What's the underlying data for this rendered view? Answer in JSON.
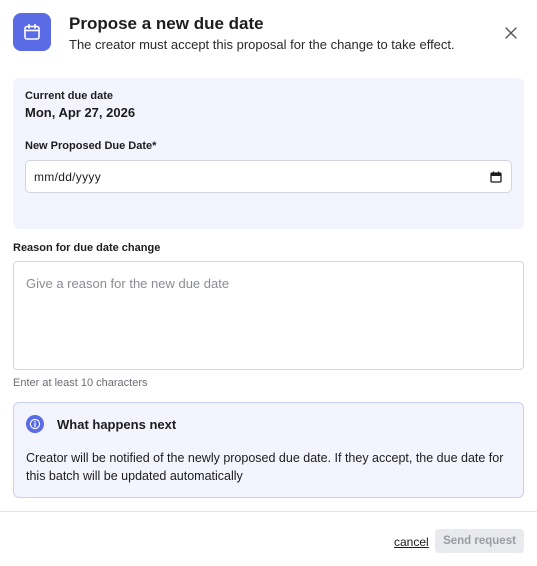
{
  "header": {
    "icon": "calendar-icon",
    "title": "Propose a new due date",
    "subtitle": "The creator must accept this proposal for the change to take effect.",
    "close_icon": "close-icon"
  },
  "current_due": {
    "label": "Current due date",
    "value": "Mon, Apr 27, 2026"
  },
  "new_due": {
    "label": "New Proposed Due Date*",
    "value": "mm/dd/yyyy",
    "picker_icon": "calendar-picker-icon"
  },
  "reason": {
    "label": "Reason for due date change",
    "placeholder": "Give a reason for the new due date",
    "value": "",
    "hint": "Enter at least 10 characters"
  },
  "info": {
    "icon": "info-icon",
    "title": "What happens next",
    "text": "Creator will be notified of the newly proposed due date. If they accept, the due date for this batch will be updated automatically"
  },
  "footer": {
    "cancel_label": "cancel",
    "send_label": "Send request"
  },
  "colors": {
    "accent": "#5a6be6",
    "panel_bg": "#f3f4fd",
    "info_border": "#c9cef6",
    "disabled_bg": "#e9eaed",
    "disabled_text": "#9a9ca3"
  }
}
